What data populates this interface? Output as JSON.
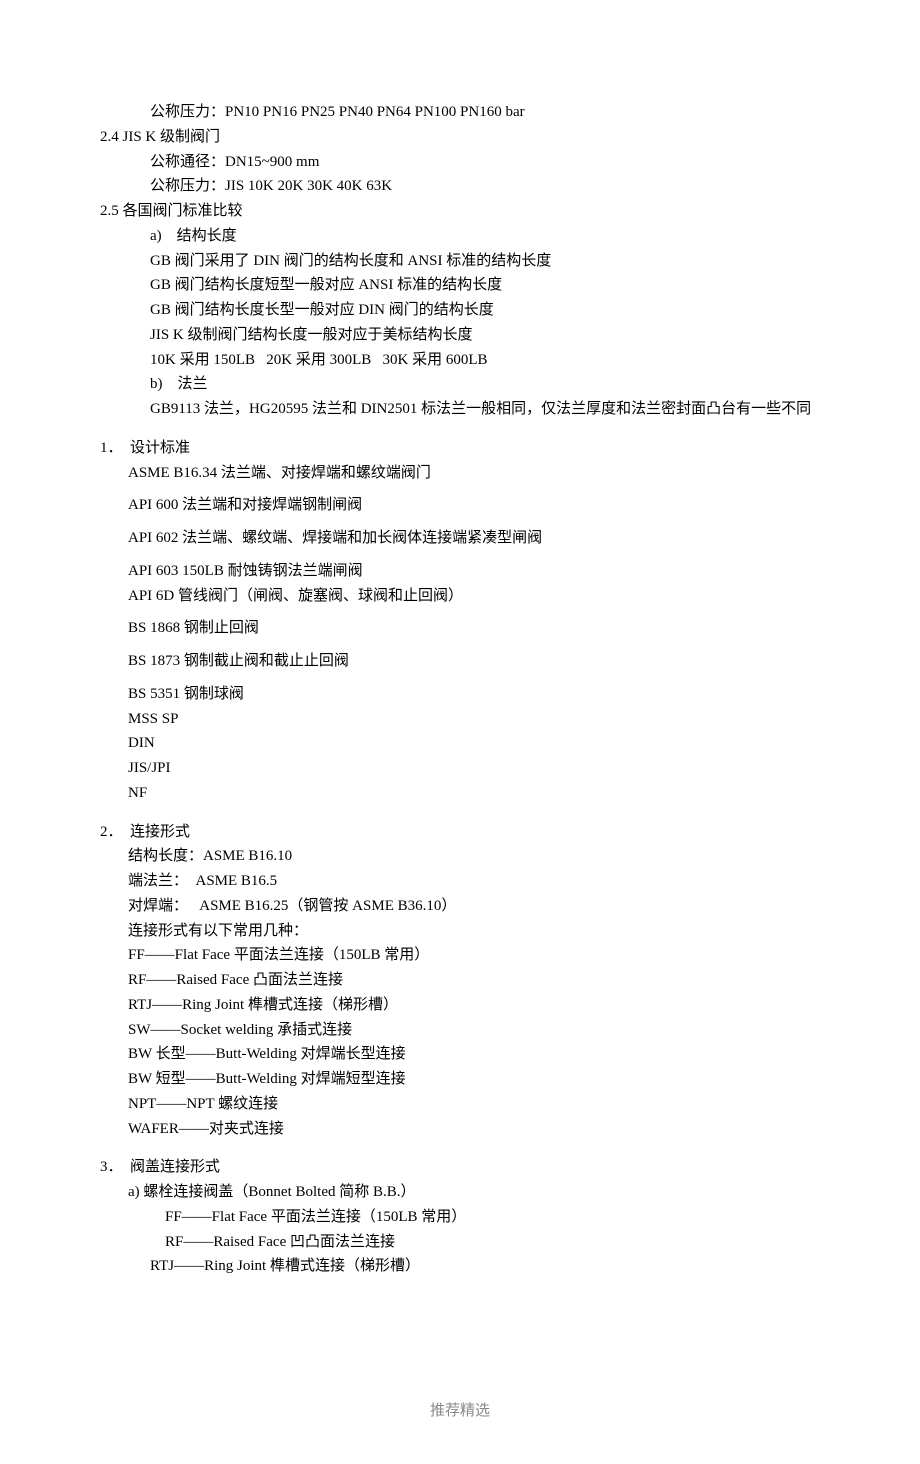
{
  "lines": {
    "l1": "公称压力：PN10 PN16 PN25 PN40 PN64 PN100 PN160 bar",
    "l2": "2.4 JIS K 级制阀门",
    "l3": "公称通径：DN15~900 mm",
    "l4": "公称压力：JIS 10K 20K 30K 40K 63K",
    "l5": "2.5 各国阀门标准比较",
    "l6": "a)    结构长度",
    "l7": "GB 阀门采用了 DIN 阀门的结构长度和 ANSI 标准的结构长度",
    "l8": "GB 阀门结构长度短型一般对应 ANSI 标准的结构长度",
    "l9": "GB 阀门结构长度长型一般对应 DIN 阀门的结构长度",
    "l10": "JIS K 级制阀门结构长度一般对应于美标结构长度",
    "l11": "10K 采用 150LB   20K 采用 300LB   30K 采用 600LB",
    "l12": "b)    法兰",
    "l13": "GB9113 法兰，HG20595 法兰和 DIN2501 标法兰一般相同，仅法兰厚度和法兰密封面凸台有一些不同",
    "l14num": "1．",
    "l14": "设计标准",
    "l15": "ASME B16.34 法兰端、对接焊端和螺纹端阀门",
    "l16": "API 600 法兰端和对接焊端钢制闸阀",
    "l17": "API 602 法兰端、螺纹端、焊接端和加长阀体连接端紧凑型闸阀",
    "l18": "API 603 150LB 耐蚀铸钢法兰端闸阀",
    "l19": "API 6D 管线阀门（闸阀、旋塞阀、球阀和止回阀）",
    "l20": "BS 1868 钢制止回阀",
    "l21": "BS 1873 钢制截止阀和截止止回阀",
    "l22": "BS 5351 钢制球阀",
    "l23": "MSS SP",
    "l24": "DIN",
    "l25": "JIS/JPI",
    "l26": "NF",
    "l27num": "2．",
    "l27": "连接形式",
    "l28": "结构长度：ASME B16.10",
    "l29": "端法兰：  ASME B16.5",
    "l30": "对焊端：   ASME B16.25（钢管按 ASME B36.10）",
    "l31": "连接形式有以下常用几种：",
    "l32": "FF——Flat Face 平面法兰连接（150LB 常用）",
    "l33": "RF——Raised Face 凸面法兰连接",
    "l34": "RTJ——Ring Joint 榫槽式连接（梯形槽）",
    "l35": "SW——Socket welding 承插式连接",
    "l36": "BW 长型——Butt-Welding 对焊端长型连接",
    "l37": "BW 短型——Butt-Welding 对焊端短型连接",
    "l38": "NPT——NPT 螺纹连接",
    "l39": "WAFER——对夹式连接",
    "l40num": "3．",
    "l40": "阀盖连接形式",
    "l41": "a) 螺栓连接阀盖（Bonnet Bolted 简称 B.B.）",
    "l42": "FF——Flat Face 平面法兰连接（150LB 常用）",
    "l43": "RF——Raised Face 凹凸面法兰连接",
    "l44": "RTJ——Ring Joint 榫槽式连接（梯形槽）"
  },
  "footer": "推荐精选"
}
